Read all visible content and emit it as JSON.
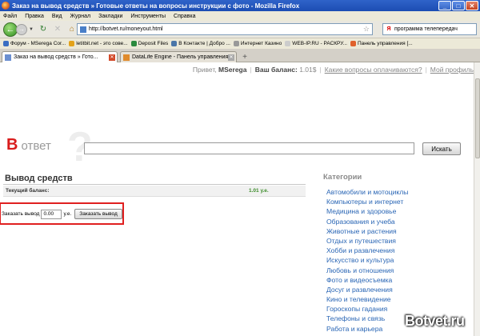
{
  "window": {
    "title": "Заказ на вывод средств » Готовые ответы на вопросы инструкции с фото - Mozilla Firefox",
    "minimize_glyph": "_",
    "maximize_glyph": "□",
    "close_glyph": "✕"
  },
  "menu": [
    "Файл",
    "Правка",
    "Вид",
    "Журнал",
    "Закладки",
    "Инструменты",
    "Справка"
  ],
  "nav": {
    "back_icon": "back-arrow-icon",
    "forward_icon": "forward-arrow-icon",
    "url": "http://botvet.ru/moneyout.html",
    "search_query": "программа телепередач"
  },
  "bookmarks": [
    {
      "label": "Форум - MSerega Cor...",
      "color": "#3a6ec2"
    },
    {
      "label": "letitbit.net - это сове...",
      "color": "#e3a21a"
    },
    {
      "label": "Deposit Files",
      "color": "#2b8a3e"
    },
    {
      "label": "В Контакте | Добро ...",
      "color": "#4a76a8"
    },
    {
      "label": "Интернет Казино",
      "color": "#999999"
    },
    {
      "label": "WEB-IP.RU - РАСКРУ...",
      "color": "#cccccc"
    },
    {
      "label": "Панель управления [...",
      "color": "#e0612b"
    }
  ],
  "tabs": [
    {
      "label": "Заказ на вывод средств » Гото...",
      "active": true
    },
    {
      "label": "DataLife Engine - Панель управления",
      "active": false
    }
  ],
  "page": {
    "greeting": "Привет,",
    "username": "MSerega",
    "balance_label": "Ваш баланс:",
    "balance_value": "1.01$",
    "link_paid_questions": "Какие вопросы оплачиваются?",
    "link_my_profile": "Мой профиль",
    "logo_letter": "В",
    "logo_word": "ответ",
    "logo_q": "?",
    "search_button": "Искать",
    "section_title": "Вывод средств",
    "current_balance_label": "Текущий баланс:",
    "current_balance_value": "1.01 у.е.",
    "order_label": "Заказать вывод",
    "order_amount": "0.00",
    "order_unit": "у.е.",
    "order_button": "Заказать вывод",
    "categories_title": "Категории",
    "categories": [
      "Автомобили и мотоциклы",
      "Компьютеры и интернет",
      "Медицина и здоровье",
      "Образования и учеба",
      "Животные и растения",
      "Отдых и путешествия",
      "Хобби и развлечения",
      "Искусство и культура",
      "Любовь и отношения",
      "Фото и видеосъемка",
      "Досуг и развлечения",
      "Кино и телевидение",
      "Гороскопы гадания",
      "Телефоны и связь",
      "Работа и карьера"
    ],
    "watermark": "Botvet.ru"
  }
}
